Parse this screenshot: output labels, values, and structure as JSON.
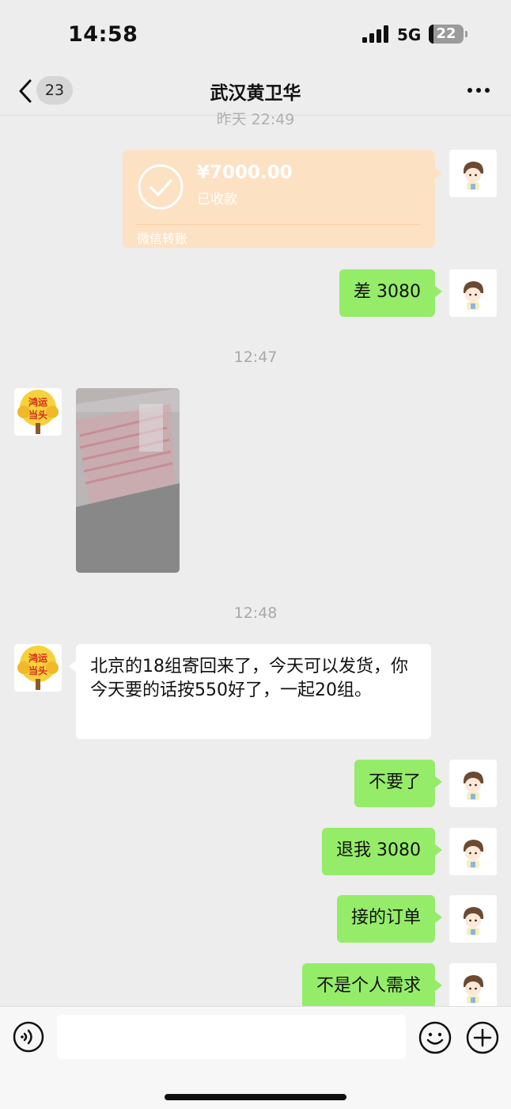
{
  "status_bar": {
    "time": "14:58",
    "network": "5G",
    "battery": "22"
  },
  "header": {
    "unread_count": "23",
    "title": "武汉黄卫华"
  },
  "messages": {
    "ts_partial": "昨天 22:49",
    "transfer": {
      "amount": "¥7000.00",
      "status": "已收款",
      "label": "微信转账"
    },
    "msg_diff": "差 3080",
    "ts_1": "12:47",
    "ts_2": "12:48",
    "msg_incoming": "北京的18组寄回来了，今天可以发货，你今天要的话按550好了，一起20组。",
    "msg_no": "不要了",
    "msg_refund": "退我 3080",
    "msg_order": "接的订单",
    "msg_not_personal": "不是个人需求"
  },
  "avatar_contact_text": "鸿运当头",
  "colors": {
    "my_bubble": "#95ec69",
    "transfer_card": "#fde1c3",
    "background": "#ededed"
  }
}
